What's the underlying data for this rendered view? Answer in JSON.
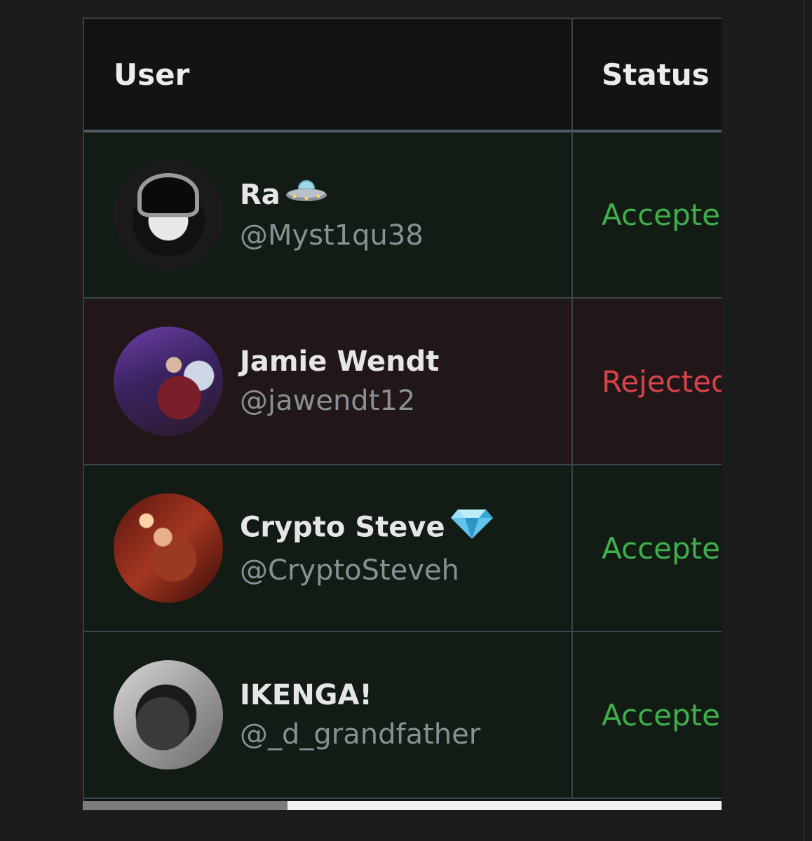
{
  "table": {
    "headers": {
      "user": "User",
      "status": "Status"
    },
    "rows": [
      {
        "display_name": "Ra",
        "name_emoji": "ufo-icon",
        "handle": "@Myst1qu38",
        "status": "Accepted",
        "avatar": "portrait-woman-bw"
      },
      {
        "display_name": "Jamie Wendt",
        "name_emoji": "",
        "handle": "@jawendt12",
        "status": "Rejected",
        "avatar": "photo-party-purple"
      },
      {
        "display_name": "Crypto Steve",
        "name_emoji": "gem-icon",
        "handle": "@CryptoSteveh",
        "status": "Accepted",
        "avatar": "photo-red-scene"
      },
      {
        "display_name": "IKENGA!",
        "name_emoji": "",
        "handle": "@_d_grandfather",
        "status": "Accepted",
        "avatar": "portrait-man-bw"
      }
    ]
  },
  "colors": {
    "accepted": "#3fae4c",
    "rejected": "#d8434b",
    "accepted_row_bg": "#131c14",
    "rejected_row_bg": "#221718"
  },
  "scrollbar": {
    "position_fraction": 0.0,
    "visible_fraction": 0.32
  }
}
